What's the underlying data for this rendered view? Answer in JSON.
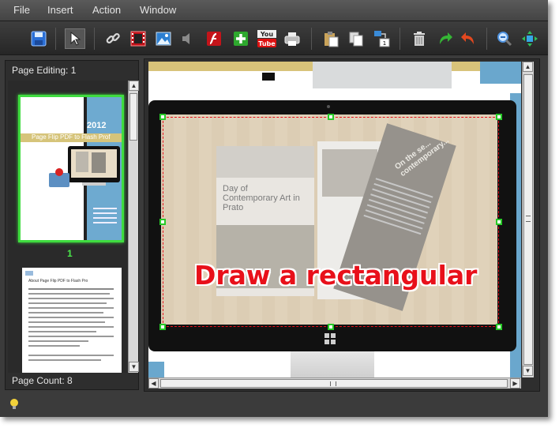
{
  "menu": {
    "items": [
      "File",
      "Insert",
      "Action",
      "Window"
    ]
  },
  "toolbar": {
    "buttons": [
      "save-icon",
      "select-pointer-icon",
      "link-icon",
      "video-icon",
      "image-icon",
      "audio-icon",
      "flash-icon",
      "add-icon",
      "youtube-icon",
      "print-icon",
      "paste-icon",
      "copy-icon",
      "apply-to-page-icon",
      "delete-icon",
      "redo-icon",
      "undo-icon",
      "zoom-out-icon",
      "fit-icon"
    ],
    "youtube_text": "You Tube",
    "apply_page_number": "1",
    "accent": "#2ea82e"
  },
  "left_panel": {
    "title": "Page Editing: 1",
    "page_count": "Page Count: 8",
    "thumb1": {
      "number": "1",
      "year": "2012",
      "title": "Page Flip PDF to Flash Prof"
    },
    "thumb2": {
      "heading": "About Page Flip PDF to Flash Pro"
    }
  },
  "canvas": {
    "magazine_title": "Day of Contemporary Art in Prato",
    "magazine_sub": "On the se... contemporary...",
    "overlay_text": "Draw a rectangular",
    "overlay_color": "#e8101a",
    "selection_color": "#27c927"
  }
}
